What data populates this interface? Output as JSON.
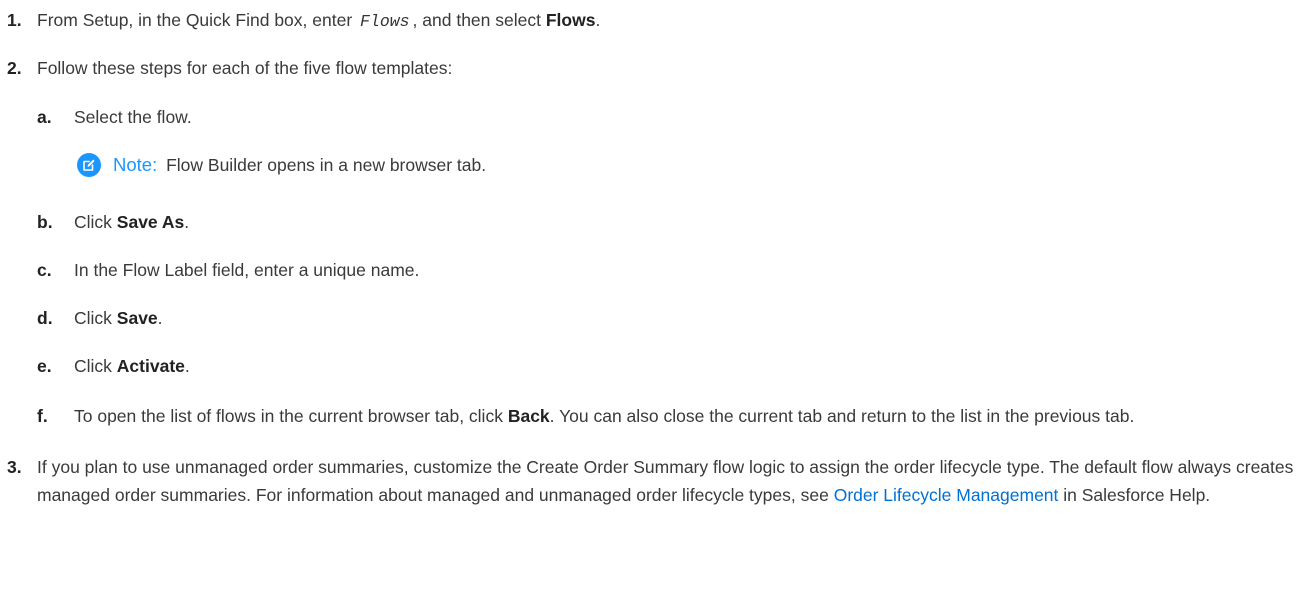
{
  "steps": [
    {
      "num": "1.",
      "pre": "From Setup, in the Quick Find box, enter",
      "code": "Flows",
      "mid": ", and then select",
      "bold": "Flows",
      "post": "."
    },
    {
      "num": "2.",
      "text": "Follow these steps for each of the five flow templates:",
      "substeps": [
        {
          "letter": "a.",
          "text": "Select the flow."
        },
        {
          "letter": "b.",
          "pre": "Click",
          "bold": "Save As",
          "post": "."
        },
        {
          "letter": "c.",
          "text": "In the Flow Label field, enter a unique name."
        },
        {
          "letter": "d.",
          "pre": "Click",
          "bold": "Save",
          "post": "."
        },
        {
          "letter": "e.",
          "pre": "Click",
          "bold": "Activate",
          "post": "."
        },
        {
          "letter": "f.",
          "pre": "To open the list of flows in the current browser tab, click",
          "bold": "Back",
          "post": ". You can also close the current tab and return to the list in the previous tab."
        }
      ]
    },
    {
      "num": "3.",
      "pre": "If you plan to use unmanaged order summaries, customize the Create Order Summary flow logic to assign the order lifecycle type. The default flow always creates managed order summaries. For information about managed and unmanaged order lifecycle types, see",
      "link": "Order Lifecycle Management",
      "post": "in Salesforce Help."
    }
  ],
  "note": {
    "label": "Note:",
    "text": "Flow Builder opens in a new browser tab.",
    "icon": "edit-note-icon",
    "color": "#1b96ff"
  },
  "colors": {
    "link": "#0070d2",
    "accent": "#1b96ff"
  }
}
